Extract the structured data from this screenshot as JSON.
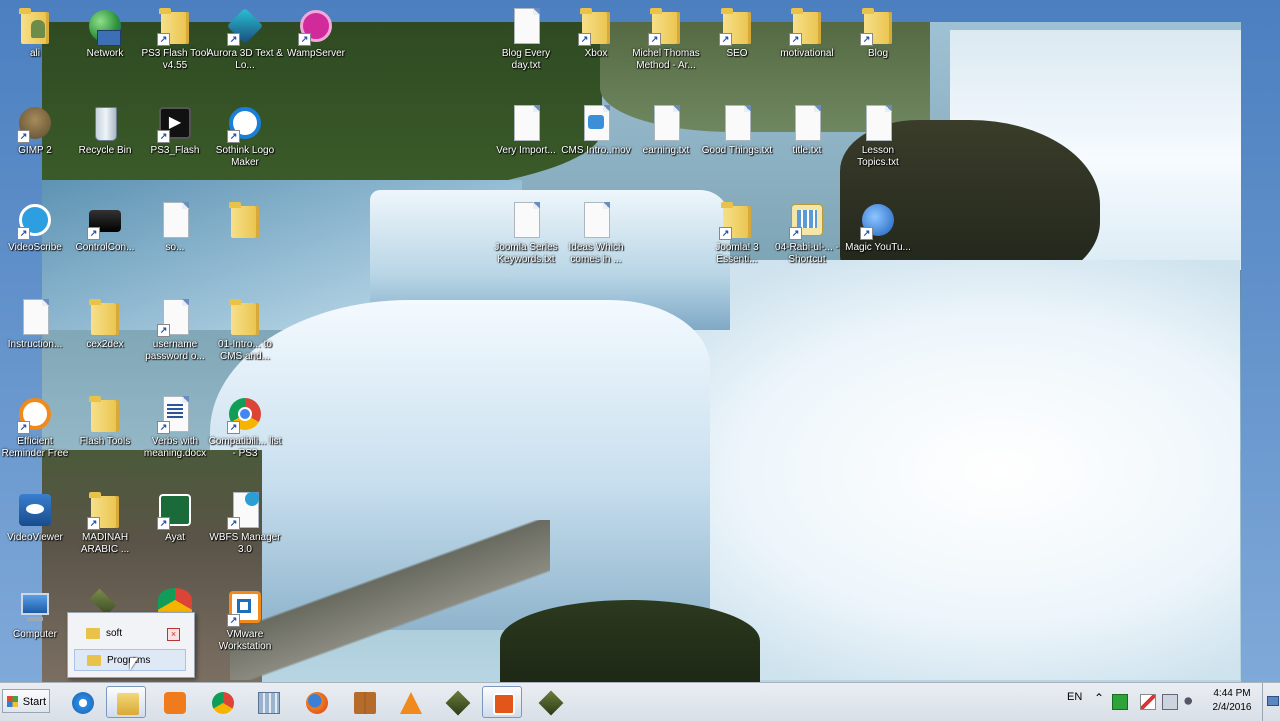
{
  "desktop": {
    "icons": [
      {
        "name": "ali",
        "label": "ali"
      },
      {
        "name": "network",
        "label": "Network"
      },
      {
        "name": "ps3-flash-tool",
        "label": "PS3 Flash Tool v4.55"
      },
      {
        "name": "aurora-3d",
        "label": "Aurora 3D Text & Lo..."
      },
      {
        "name": "wampserver",
        "label": "WampServer"
      },
      {
        "name": "blog-every-day",
        "label": "Blog Every day.txt"
      },
      {
        "name": "xbox",
        "label": "Xbox"
      },
      {
        "name": "michel-thomas",
        "label": "Michel Thomas Method - Ar..."
      },
      {
        "name": "seo",
        "label": "SEO"
      },
      {
        "name": "motivational",
        "label": "motivational"
      },
      {
        "name": "blog",
        "label": "Blog"
      },
      {
        "name": "gimp-2",
        "label": "GIMP 2"
      },
      {
        "name": "recycle-bin",
        "label": "Recycle Bin"
      },
      {
        "name": "ps3-flash",
        "label": "PS3_Flash"
      },
      {
        "name": "sothink-logo-maker",
        "label": "Sothink Logo Maker"
      },
      {
        "name": "very-import",
        "label": "Very Import..."
      },
      {
        "name": "cms-intro",
        "label": "CMS Intro..mov"
      },
      {
        "name": "earning",
        "label": "earning.txt"
      },
      {
        "name": "good-things",
        "label": "Good Things.txt"
      },
      {
        "name": "title",
        "label": "title.txt"
      },
      {
        "name": "lesson-topics",
        "label": "Lesson Topics.txt"
      },
      {
        "name": "videoscribe",
        "label": "VideoScribe"
      },
      {
        "name": "controlcon",
        "label": "ControlCon..."
      },
      {
        "name": "so",
        "label": "so..."
      },
      {
        "name": "folder-r3c4",
        "label": ""
      },
      {
        "name": "joomla-series-keywords",
        "label": "Joomla Series Keywords.txt"
      },
      {
        "name": "ideas-which",
        "label": "Ideas Which comes in ..."
      },
      {
        "name": "joomla-3",
        "label": "Joomla! 3 Essenti..."
      },
      {
        "name": "rabi-ul-shortcut",
        "label": "04-Rabi-ul-... - Shortcut"
      },
      {
        "name": "magic-youtube",
        "label": "Magic YouTu..."
      },
      {
        "name": "instruction",
        "label": "Instruction..."
      },
      {
        "name": "cex2dex",
        "label": "cex2dex"
      },
      {
        "name": "username-password",
        "label": "username password o..."
      },
      {
        "name": "intro-cms",
        "label": "01-Intro... to CMS and..."
      },
      {
        "name": "efficient-reminder",
        "label": "Efficient Reminder Free"
      },
      {
        "name": "flash-tools",
        "label": "Flash Tools"
      },
      {
        "name": "verbs-with-meaning",
        "label": "Verbs with meaning.docx"
      },
      {
        "name": "compatibility-list",
        "label": "Compatibili... list - PS3"
      },
      {
        "name": "videoviewer",
        "label": "VideoViewer"
      },
      {
        "name": "madinah-arabic",
        "label": "MADINAH ARABIC ..."
      },
      {
        "name": "ayat",
        "label": "Ayat"
      },
      {
        "name": "wbfs-manager",
        "label": "WBFS Manager 3.0"
      },
      {
        "name": "computer",
        "label": "Computer"
      },
      {
        "name": "vmware-workstation",
        "label": "VMware Workstation"
      }
    ]
  },
  "popup": {
    "items": [
      {
        "label": "soft"
      },
      {
        "label": "Programs"
      }
    ],
    "close_glyph": "×"
  },
  "taskbar": {
    "start_label": "Start",
    "language": "EN",
    "time": "4:44 PM",
    "date": "2/4/2016",
    "tray_chevron": "⌃"
  },
  "colors": {
    "desktop_bg": "#2a6fb8",
    "taskbar_bg": "#dde3ea",
    "folder": "#e9c24a"
  }
}
